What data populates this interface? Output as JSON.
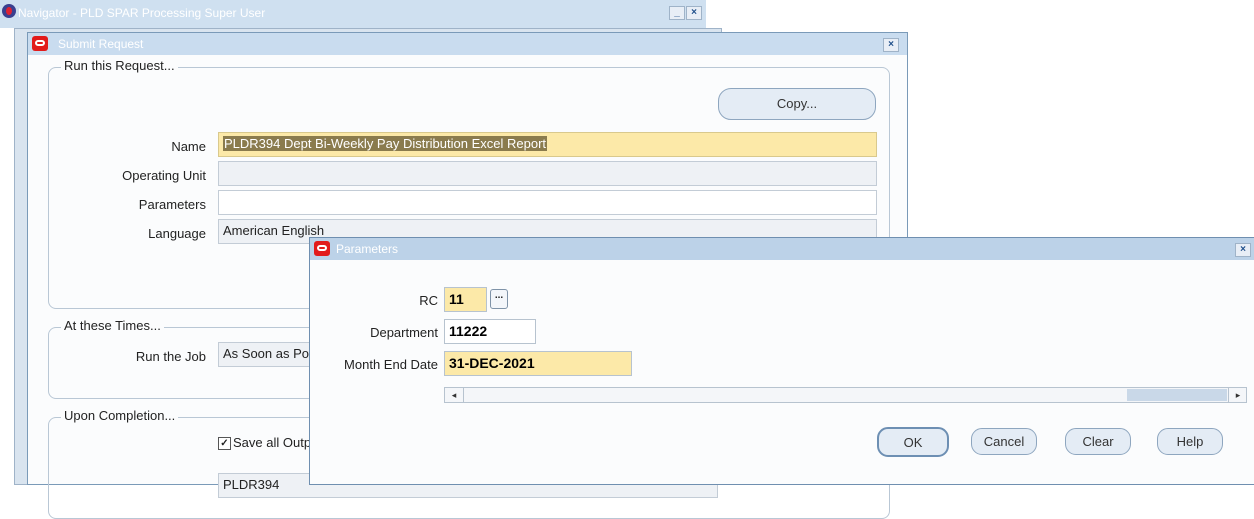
{
  "navigator": {
    "title": "Navigator - PLD SPAR Processing Super User",
    "minimize": "_",
    "close": "×"
  },
  "submit_request": {
    "title": "Submit Request",
    "close": "×",
    "run_group_label": "Run this Request...",
    "copy_button": "Copy...",
    "fields": {
      "name_label": "Name",
      "name_value": "PLDR394 Dept Bi-Weekly Pay Distribution Excel Report",
      "operating_unit_label": "Operating Unit",
      "operating_unit_value": "",
      "parameters_label": "Parameters",
      "parameters_value": "",
      "language_label": "Language",
      "language_value": "American English"
    },
    "times_group_label": "At these Times...",
    "run_job_label": "Run the Job",
    "run_job_value": "As Soon as Possible",
    "completion_group_label": "Upon Completion...",
    "save_output_checked": true,
    "save_output_label": "Save all Output Files",
    "layout_value": "PLDR394"
  },
  "parameters_dialog": {
    "title": "Parameters",
    "close": "×",
    "rc_label": "RC",
    "rc_value": "11",
    "lov_button": "...",
    "department_label": "Department",
    "department_value": "11222",
    "month_end_label": "Month End Date",
    "month_end_value": "31-DEC-2021",
    "scroll_left": "◂",
    "scroll_right": "▸",
    "buttons": {
      "ok": "OK",
      "cancel": "Cancel",
      "clear": "Clear",
      "help": "Help"
    }
  },
  "colors": {
    "required_field": "#fce9a8",
    "title_bar": "#c9dcef",
    "oracle_red": "#e21b1b"
  }
}
